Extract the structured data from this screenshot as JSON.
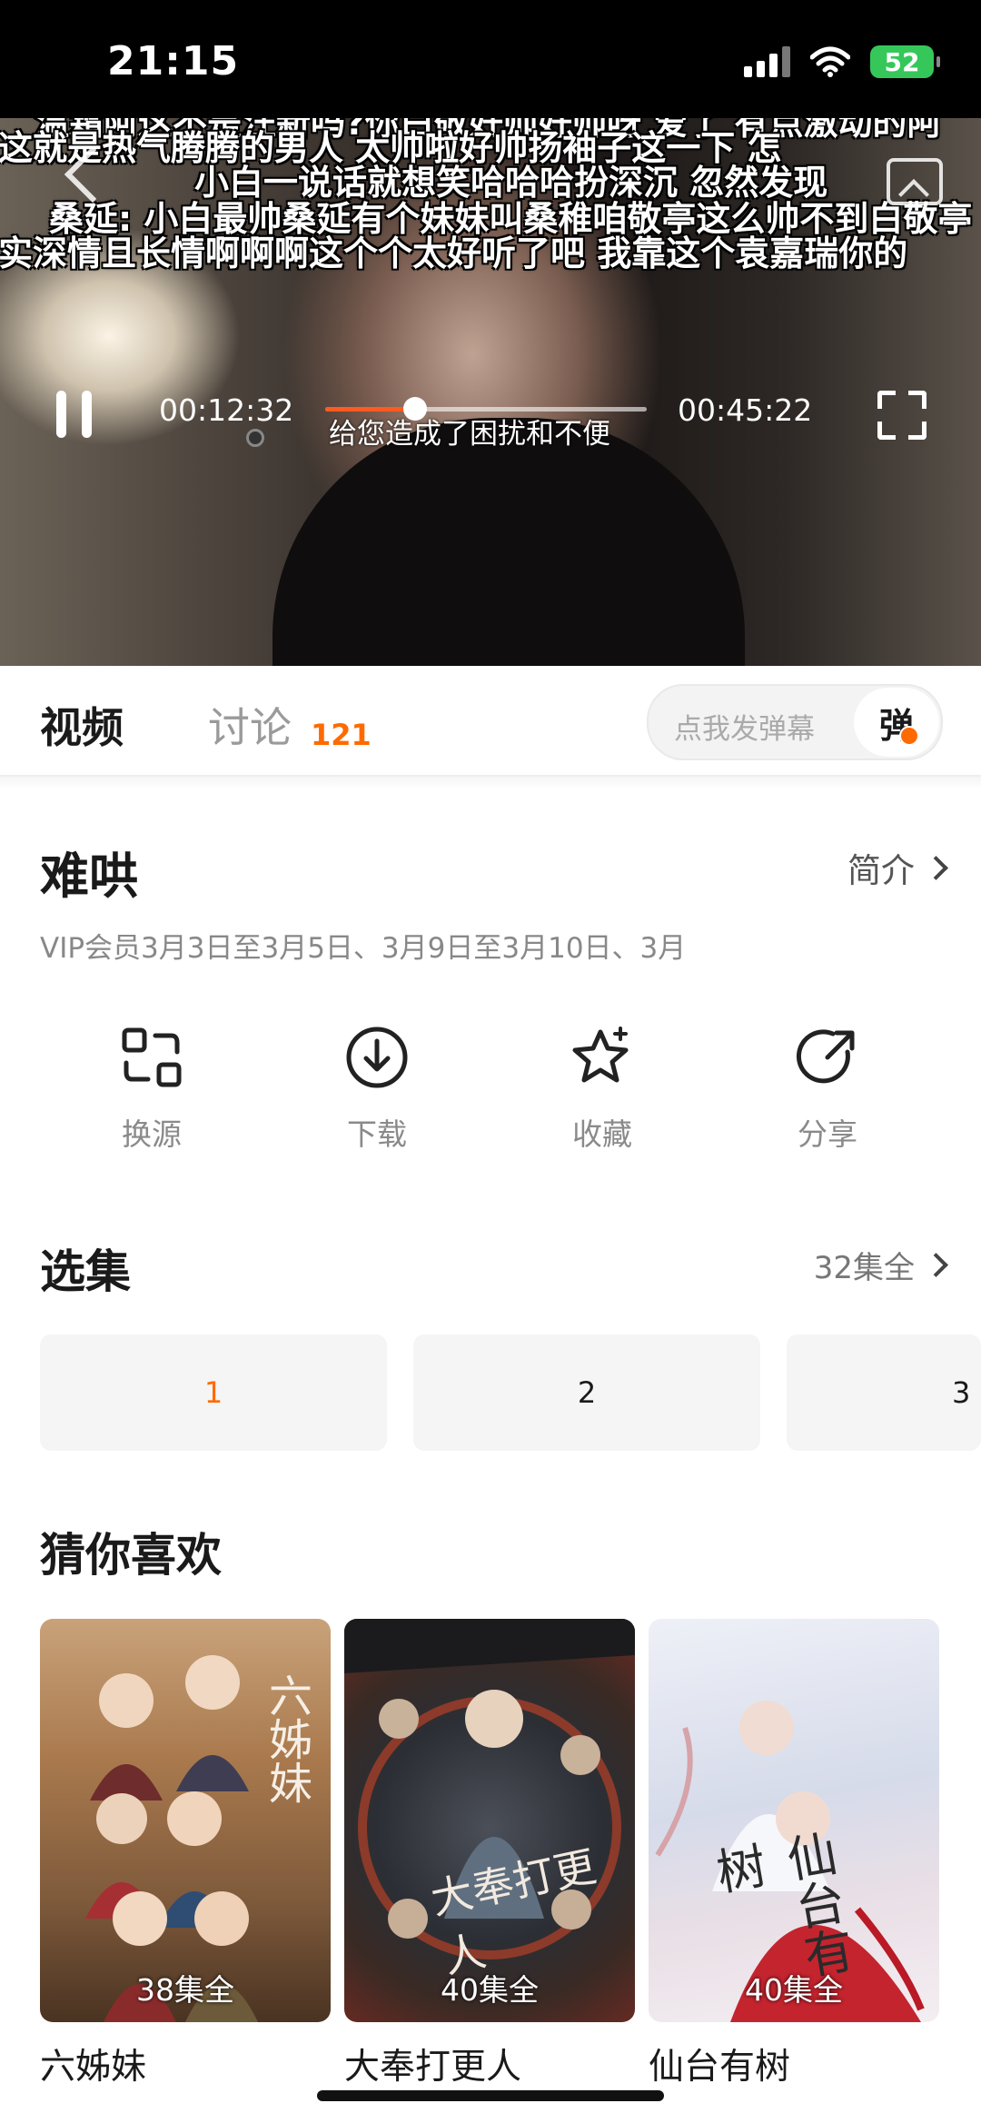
{
  "status_bar": {
    "time": "21:15",
    "battery": "52"
  },
  "player": {
    "danmaku": [
      "温霜阿这不是汪新吗?你白敬好帅好帅呀  爱了      有点激动的阿",
      "这就是热气腾腾的男人      太帅啦好帅扬袖子这一下          怎",
      "小白一说话就想笑哈哈哈扮深沉              忽然发现",
      "桑延: 小白最帅桑延有个妹妹叫桑稚咱敬亭这么帅不到白敬亭",
      "实深情且长情啊啊啊这个个太好听了吧          我靠这个袁嘉瑞你的"
    ],
    "current_time": "00:12:32",
    "total_time": "00:45:22",
    "progress": 0.28,
    "subtitle": "给您造成了困扰和不便"
  },
  "tabs": {
    "video": "视频",
    "discussion": "讨论",
    "discussion_count": "121",
    "danmaku_placeholder": "点我发弹幕",
    "danmaku_button": "弹"
  },
  "show": {
    "title": "难哄",
    "intro_label": "简介",
    "update_info": "VIP会员3月3日至3月5日、3月9日至3月10日、3月"
  },
  "actions": [
    {
      "label": "换源",
      "icon": "switch-source-icon"
    },
    {
      "label": "下载",
      "icon": "download-icon"
    },
    {
      "label": "收藏",
      "icon": "star-icon"
    },
    {
      "label": "分享",
      "icon": "share-icon"
    }
  ],
  "episodes": {
    "title": "选集",
    "total_label": "32集全",
    "items": [
      "1",
      "2",
      "3"
    ],
    "active_index": 0,
    "accent_color": "#ff6a00"
  },
  "recommend": {
    "title": "猜你喜欢",
    "items": [
      {
        "name": "六姊妹",
        "badge": "38集全"
      },
      {
        "name": "大奉打更人",
        "badge": "40集全"
      },
      {
        "name": "仙台有树",
        "badge": "40集全"
      }
    ]
  }
}
